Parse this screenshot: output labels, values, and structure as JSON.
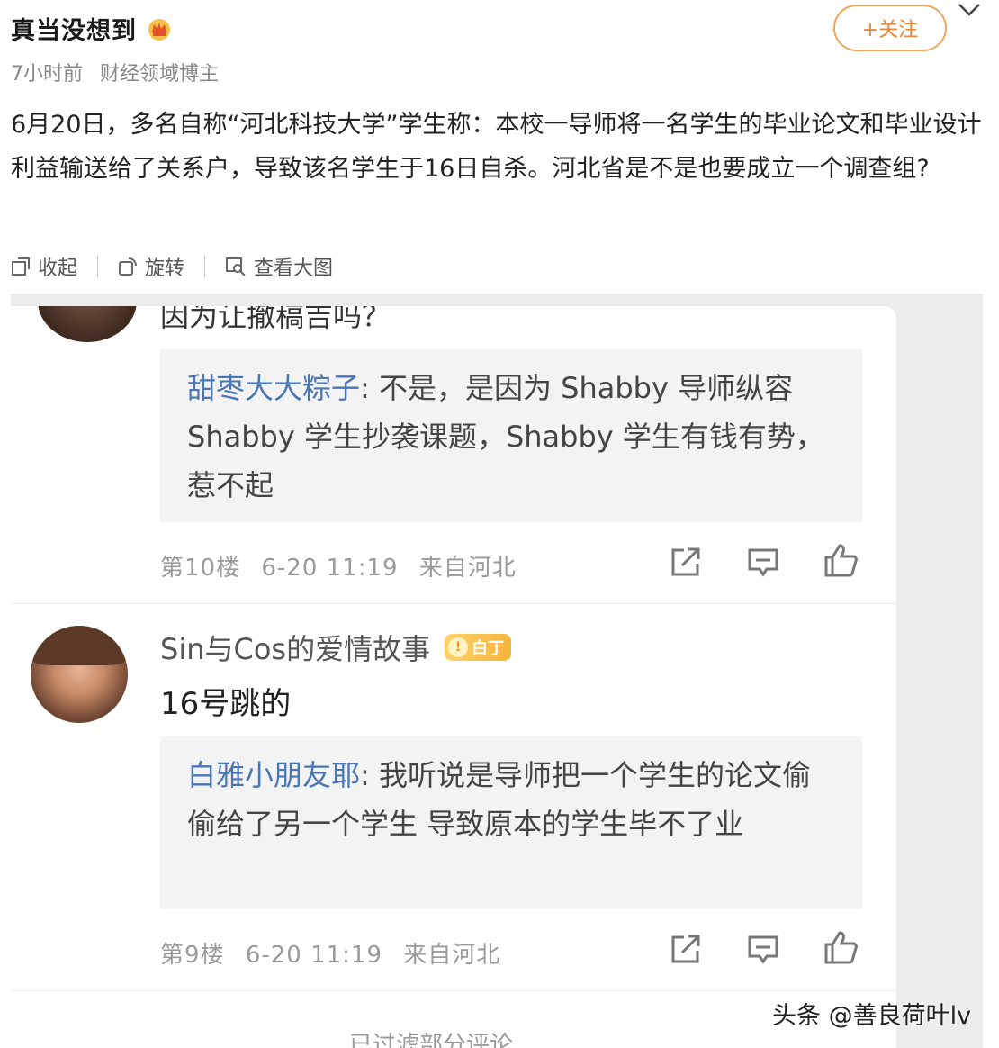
{
  "post": {
    "author": "真当没想到",
    "follow_label": "+关注",
    "time": "7小时前",
    "role": "财经领域博主",
    "text": "6月20日，多名自称“河北科技大学”学生称：本校一导师将一名学生的毕业论文和毕业设计利益输送给了关系户，导致该名学生于16日自杀。河北省是不是也要成立一个调查组?",
    "actions": {
      "collapse": "收起",
      "rotate": "旋转",
      "view_large": "查看大图"
    }
  },
  "screenshot": {
    "partial_text": "因为让撤稿吉吗？",
    "comments": [
      {
        "quote_name": "甜枣大大粽子",
        "quote_text": "不是，是因为 Shabby 导师纵容 Shabby 学生抄袭课题，Shabby 学生有钱有势，惹不起",
        "floor": "第10楼",
        "date": "6-20 11:19",
        "location": "来自河北"
      },
      {
        "name": "Sin与Cos的爱情故事",
        "badge": "白丁",
        "text": "16号跳的",
        "quote_name": "白雅小朋友耶",
        "quote_text": "我听说是导师把一个学生的论文偷偷给了另一个学生 导致原本的学生毕不了业",
        "floor": "第9楼",
        "date": "6-20 11:19",
        "location": "来自河北"
      }
    ],
    "filtered_text": "已过滤部分评论"
  },
  "watermark": "头条 @善良荷叶lv",
  "colors": {
    "accent": "#e8873a",
    "quote_name": "#4a76b3",
    "badge": "#f7b43b"
  }
}
